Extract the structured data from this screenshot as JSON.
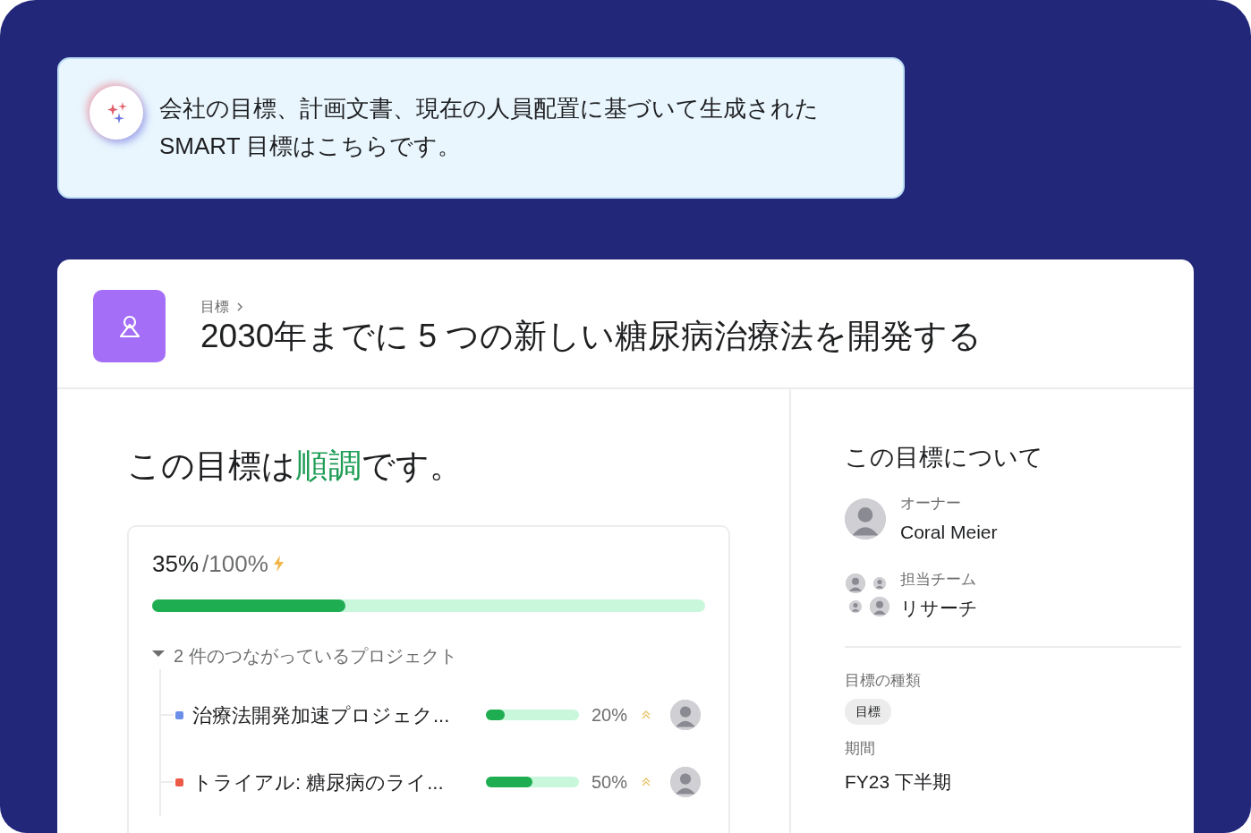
{
  "banner": {
    "text": "会社の目標、計画文書、現在の人員配置に基づいて生成された SMART 目標はこちらです。"
  },
  "goal": {
    "breadcrumb": "目標",
    "title": "2030年までに 5 つの新しい糖尿病治療法を開発する"
  },
  "status": {
    "before": "この目標は",
    "word": "順調",
    "after": "です。",
    "color": "#1f9d55"
  },
  "progress": {
    "value": "35%",
    "total": "/100%",
    "level": 0.35,
    "projects_toggle": {
      "label": "2 件のつながっているプロジェクト",
      "expanded": true
    },
    "projects": [
      {
        "name": "治療法開発加速プロジェク...",
        "color": "#6b8fe8",
        "level": 0.2,
        "percent": "20%"
      },
      {
        "name": "トライアル: 糖尿病のライ...",
        "color": "#ee5a48",
        "level": 0.5,
        "percent": "50%"
      }
    ]
  },
  "about": {
    "title": "この目標について",
    "owner": {
      "label": "オーナー",
      "name": "Coral Meier"
    },
    "team": {
      "label": "担当チーム",
      "name": "リサーチ"
    },
    "type": {
      "label": "目標の種類",
      "tag": "目標"
    },
    "period": {
      "label": "期間",
      "value": "FY23 下半期"
    }
  }
}
